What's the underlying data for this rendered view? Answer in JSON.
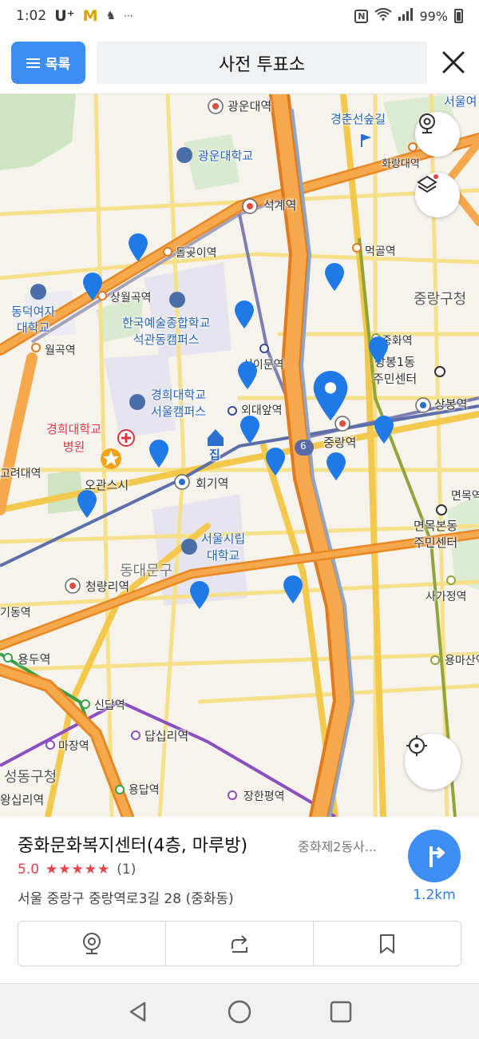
{
  "status_bar": {
    "time": "1:02",
    "carrier": "U⁺",
    "app_letter": "M",
    "more": "···",
    "battery": "99%",
    "icons": [
      "nfc-icon",
      "wifi-icon",
      "signal-icon",
      "battery-icon"
    ]
  },
  "top_bar": {
    "list_button_label": "목록",
    "search_title": "사전 투표소",
    "close_icon": "close-icon"
  },
  "map": {
    "labels": {
      "gwangun_station": "광운대역",
      "gwangun_univ": "광운대학교",
      "gyeongchun_forest": "경춘선숲길",
      "seoul_top": "서울여",
      "hwarang_station": "화랑대역",
      "seokgye_station": "석계역",
      "dolgoji_station": "돌곶이역",
      "meokgol_station": "먹골역",
      "sangwolgok_station": "상월곡역",
      "jungnang_gu": "중랑구청",
      "dongduk_univ": "동덕여자\n대학교",
      "knua_campus": "한국예술종합학교\n석관동캠퍼스",
      "junghwa_station": "중화역",
      "wolgok_station": "월곡역",
      "sinimun_station": "신이문역",
      "sangbong1_center": "상봉1동\n주민센터",
      "khu_campus": "경희대학교\n서울캠퍼스",
      "hufs_station": "외대앞역",
      "sangbong_station": "상봉역",
      "khu_hospital": "경희대학교\n병원",
      "home_label": "집",
      "route_6": "6",
      "jungnang_station": "중랑역",
      "korea_univ_station": "고려대역",
      "hoegi_station": "회기역",
      "myeonmok_station": "면목역",
      "ogansi": "오관스시",
      "myeonmokbon_center": "면목본동\n주민센터",
      "uos_univ": "서울시립\n대학교",
      "dongdaemun_gu": "동대문구",
      "cheongnyangni_station": "청량리역",
      "sagajeong_station": "사가정역",
      "jegi_station": "기동역",
      "yongdu_station": "용두역",
      "yongma_station": "용마산역",
      "sindap_station": "신답역",
      "dapsimni_station": "답십리역",
      "majang_station": "마장역",
      "seongdong_gu": "성동구청",
      "yongdap_station": "용답역",
      "janghanpyeong_station": "장한평역",
      "wangsimni_station": "왕십리역"
    }
  },
  "place": {
    "name": "중화문화복지센터(4층, 마루방)",
    "subtitle": "중화제2동사...",
    "rating_value": "5.0",
    "rating_stars": "★★★★★",
    "rating_count": "(1)",
    "address": "서울 중랑구 중랑역로3길 28 (중화동)",
    "distance": "1.2km"
  },
  "colors": {
    "accent": "#3d8df2",
    "pin": "#1f7ae8",
    "highway": "#f29a35",
    "rating": "#e8424b"
  }
}
